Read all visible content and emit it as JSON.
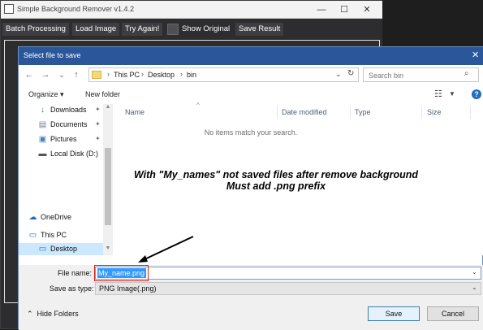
{
  "app": {
    "title": "Simple Background Remover v1.4.2",
    "toolbar": {
      "batch": "Batch Processing",
      "load": "Load Image",
      "try_again": "Try Again!",
      "show_original": "Show Original",
      "save_result": "Save Result"
    },
    "window_buttons": {
      "min": "—",
      "max": "☐",
      "close": "✕"
    }
  },
  "dialog": {
    "title": "Select file to save",
    "close": "✕",
    "nav": {
      "back": "←",
      "forward": "→",
      "down": "⌄",
      "up": "↑"
    },
    "breadcrumb": [
      "This PC",
      "Desktop",
      "bin"
    ],
    "search": {
      "placeholder": "Search bin"
    },
    "commands": {
      "organize": "Organize ▾",
      "new_folder": "New folder"
    },
    "nav_pane": [
      {
        "label": "Downloads",
        "icon": "download-icon"
      },
      {
        "label": "Documents",
        "icon": "document-icon"
      },
      {
        "label": "Pictures",
        "icon": "pictures-icon"
      },
      {
        "label": "Local Disk (D:)",
        "icon": "drive-icon"
      },
      {
        "label": "OneDrive",
        "icon": "cloud-icon"
      },
      {
        "label": "This PC",
        "icon": "computer-icon"
      },
      {
        "label": "Desktop",
        "icon": "desktop-icon"
      }
    ],
    "columns": [
      "Name",
      "Date modified",
      "Type",
      "Size"
    ],
    "empty_message": "No items match your search.",
    "file_name_label": "File name:",
    "file_name_value": "My_name.png",
    "save_as_type_label": "Save as type:",
    "save_as_type_value": "PNG Image(.png)",
    "hide_folders": "Hide Folders",
    "save": "Save",
    "cancel": "Cancel"
  },
  "annotation": {
    "line1": "With \"My_names\" not saved files after remove background",
    "line2": "Must add .png prefix",
    "color": "#e02020"
  },
  "colors": {
    "accent": "#2b579a",
    "selection": "#3399ff",
    "nav_selected": "#cce8ff"
  }
}
